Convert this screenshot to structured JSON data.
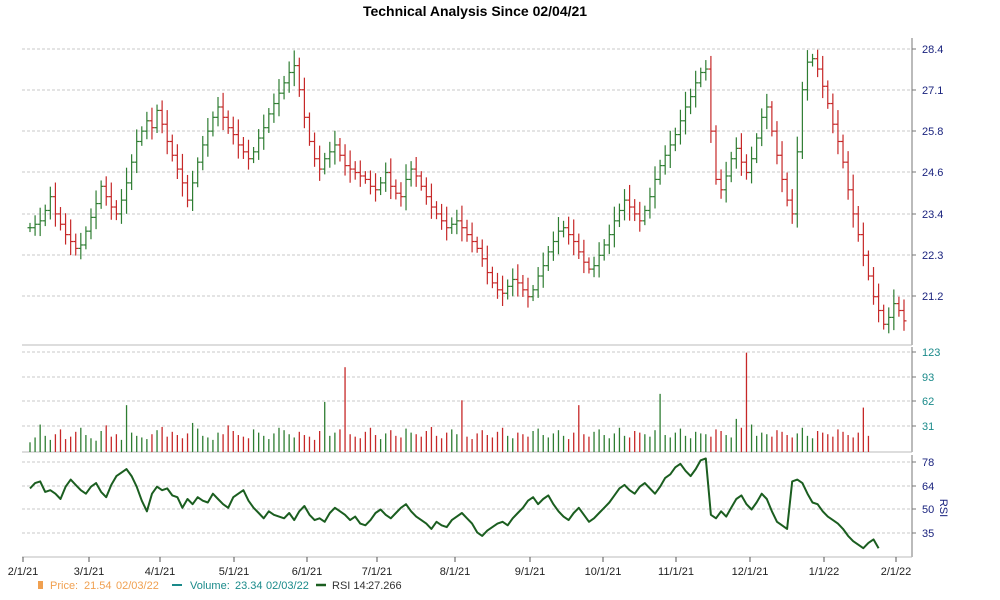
{
  "chart_data": {
    "title": "Technical Analysis Since 02/04/21",
    "colors": {
      "up": "#2e7d32",
      "down": "#c62828",
      "grid": "#c8c8c8",
      "price_legend": "#f0a050",
      "volume_legend": "#1a8a8a",
      "rsi_line": "#1b5e20",
      "price_axis": "#1a237e"
    },
    "x_tick_labels": [
      "2/1/21",
      "3/1/21",
      "4/1/21",
      "5/1/21",
      "6/1/21",
      "7/1/21",
      "8/1/21",
      "9/1/21",
      "10/1/21",
      "11/1/21",
      "12/1/21",
      "1/1/22",
      "2/1/22"
    ],
    "panels": [
      {
        "name": "price",
        "type": "ohlc",
        "ylim": [
          20.0,
          28.9
        ],
        "y_ticks": [
          "28.4",
          "27.1",
          "25.8",
          "24.6",
          "23.4",
          "22.3",
          "21.2"
        ],
        "closes": [
          23.4,
          23.5,
          23.6,
          23.9,
          24.3,
          23.8,
          23.5,
          23.2,
          23.0,
          22.8,
          22.9,
          23.3,
          23.7,
          24.1,
          24.6,
          24.3,
          24.0,
          23.8,
          24.2,
          24.7,
          25.3,
          25.9,
          26.2,
          26.5,
          26.3,
          26.8,
          26.4,
          25.9,
          25.5,
          25.1,
          24.7,
          24.2,
          24.7,
          25.3,
          25.8,
          26.2,
          26.6,
          26.9,
          26.6,
          26.3,
          26.1,
          25.8,
          25.6,
          25.4,
          25.6,
          26.0,
          26.3,
          26.7,
          27.0,
          27.3,
          27.6,
          27.9,
          28.1,
          27.4,
          26.6,
          25.9,
          25.4,
          25.1,
          25.4,
          25.6,
          25.8,
          25.5,
          25.2,
          25.1,
          25.0,
          24.9,
          24.8,
          24.6,
          24.5,
          24.7,
          25.0,
          24.6,
          24.4,
          24.3,
          24.8,
          25.1,
          24.9,
          24.6,
          24.3,
          24.0,
          23.8,
          23.6,
          23.4,
          23.5,
          23.6,
          23.4,
          23.2,
          23.0,
          22.8,
          22.5,
          22.1,
          21.8,
          21.6,
          21.5,
          21.7,
          21.9,
          21.8,
          21.6,
          21.4,
          21.6,
          22.0,
          22.3,
          22.7,
          23.0,
          23.3,
          23.4,
          23.2,
          23.0,
          22.7,
          22.4,
          22.2,
          22.3,
          22.6,
          22.9,
          23.2,
          23.6,
          23.9,
          24.2,
          24.0,
          23.8,
          23.6,
          23.9,
          24.3,
          24.8,
          25.2,
          25.5,
          25.8,
          26.1,
          26.5,
          26.9,
          27.2,
          27.6,
          27.9,
          28.0,
          26.2,
          24.8,
          24.5,
          24.9,
          25.4,
          25.7,
          25.3,
          25.0,
          25.4,
          26.0,
          26.6,
          26.9,
          26.2,
          25.5,
          24.8,
          24.2,
          23.8,
          25.6,
          27.4,
          28.2,
          28.3,
          28.0,
          27.5,
          27.0,
          26.4,
          25.9,
          25.3,
          24.5,
          23.8,
          23.2,
          22.6,
          22.0,
          21.4,
          21.0,
          20.6,
          20.8,
          21.2,
          21.0,
          20.7
        ]
      },
      {
        "name": "volume",
        "type": "bar",
        "ylim": [
          0,
          130
        ],
        "y_ticks": [
          "123",
          "93",
          "62",
          "31"
        ],
        "values": [
          12,
          18,
          34,
          20,
          15,
          22,
          28,
          16,
          19,
          25,
          30,
          21,
          17,
          14,
          26,
          33,
          19,
          22,
          15,
          58,
          24,
          20,
          18,
          16,
          22,
          27,
          31,
          19,
          25,
          21,
          17,
          23,
          36,
          29,
          20,
          18,
          15,
          24,
          22,
          33,
          26,
          21,
          19,
          17,
          28,
          24,
          20,
          16,
          23,
          30,
          27,
          22,
          18,
          25,
          21,
          19,
          15,
          26,
          62,
          20,
          24,
          28,
          105,
          22,
          19,
          17,
          25,
          30,
          21,
          16,
          23,
          27,
          20,
          18,
          29,
          24,
          22,
          19,
          26,
          31,
          20,
          17,
          24,
          28,
          22,
          64,
          19,
          16,
          23,
          27,
          21,
          18,
          25,
          30,
          20,
          17,
          24,
          22,
          19,
          26,
          29,
          21,
          18,
          23,
          27,
          20,
          16,
          24,
          58,
          22,
          19,
          25,
          28,
          21,
          17,
          23,
          30,
          20,
          18,
          26,
          24,
          22,
          19,
          27,
          72,
          21,
          18,
          24,
          29,
          20,
          17,
          25,
          23,
          22,
          19,
          28,
          26,
          21,
          18,
          41,
          30,
          123,
          34,
          20,
          24,
          22,
          19,
          27,
          25,
          21,
          18,
          23,
          30,
          20,
          17,
          26,
          24,
          22,
          19,
          28,
          25,
          21,
          18,
          24,
          55,
          20
        ]
      },
      {
        "name": "rsi",
        "type": "line",
        "ylabel": "RSI",
        "ylim": [
          22,
          80
        ],
        "y_ticks": [
          "78",
          "64",
          "50",
          "35"
        ],
        "values": [
          61,
          64,
          65,
          59,
          60,
          58,
          55,
          62,
          66,
          63,
          60,
          58,
          62,
          64,
          59,
          56,
          63,
          68,
          70,
          72,
          68,
          62,
          54,
          48,
          58,
          62,
          60,
          61,
          57,
          56,
          50,
          55,
          52,
          56,
          54,
          53,
          58,
          55,
          52,
          50,
          56,
          58,
          60,
          54,
          50,
          47,
          44,
          48,
          46,
          45,
          44,
          47,
          43,
          48,
          51,
          46,
          43,
          44,
          42,
          47,
          50,
          48,
          46,
          43,
          45,
          41,
          40,
          43,
          47,
          49,
          46,
          44,
          47,
          50,
          52,
          48,
          45,
          43,
          41,
          38,
          42,
          40,
          39,
          43,
          45,
          47,
          44,
          41,
          36,
          34,
          37,
          39,
          41,
          42,
          40,
          44,
          47,
          50,
          54,
          56,
          52,
          55,
          57,
          52,
          48,
          45,
          43,
          47,
          50,
          46,
          42,
          44,
          47,
          50,
          53,
          57,
          61,
          63,
          60,
          58,
          62,
          64,
          61,
          58,
          62,
          67,
          69,
          73,
          75,
          71,
          68,
          72,
          77,
          78,
          46,
          44,
          48,
          45,
          50,
          55,
          57,
          52,
          49,
          53,
          58,
          55,
          48,
          42,
          40,
          38,
          65,
          66,
          64,
          58,
          53,
          52,
          48,
          45,
          43,
          41,
          38,
          34,
          31,
          29,
          27,
          30,
          32,
          27
        ],
        "legend": {
          "price_label": "Price:",
          "price_value": "21.54",
          "price_date": "02/03/22",
          "volume_label": "Volume:",
          "volume_value": "23.34",
          "volume_date": "02/03/22",
          "rsi_label": "RSI 14:",
          "rsi_value": "27.266"
        }
      }
    ]
  }
}
